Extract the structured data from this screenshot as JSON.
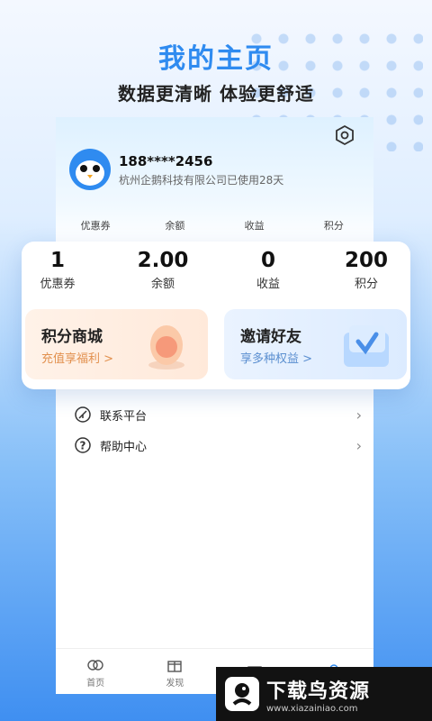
{
  "promo": {
    "title": "我的主页",
    "subtitle": "数据更清晰 体验更舒适"
  },
  "profile": {
    "phone": "188****2456",
    "company": "杭州企鹅科技有限公司已使用28天"
  },
  "mini_stats": [
    "优惠券",
    "余额",
    "收益",
    "积分"
  ],
  "stats": [
    {
      "value": "1",
      "label": "优惠券"
    },
    {
      "value": "2.00",
      "label": "余额"
    },
    {
      "value": "0",
      "label": "收益"
    },
    {
      "value": "200",
      "label": "积分"
    }
  ],
  "cards": {
    "points": {
      "title": "积分商城",
      "subtitle": "充值享福利 >"
    },
    "invite": {
      "title": "邀请好友",
      "subtitle": "享多种权益 >"
    }
  },
  "menu": [
    {
      "label": "联系平台",
      "icon": "leaf-icon"
    },
    {
      "label": "帮助中心",
      "icon": "help-icon"
    }
  ],
  "tabs": [
    {
      "label": "首页",
      "icon": "home-icon"
    },
    {
      "label": "发现",
      "icon": "gift-icon"
    }
  ],
  "watermark": {
    "title": "下载鸟资源",
    "url": "www.xiazainiao.com"
  },
  "colors": {
    "accent": "#2f8bf0",
    "points_card": "#fff2e8",
    "invite_card": "#eaf3ff"
  }
}
